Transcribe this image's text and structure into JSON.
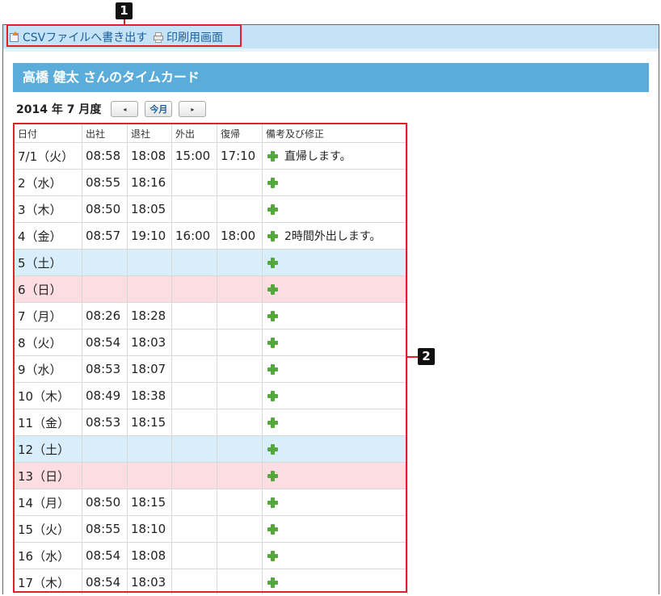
{
  "toolbar": {
    "csv_export": "CSVファイルへ書き出す",
    "print_view": "印刷用画面"
  },
  "page_title": "高橋 健太 さんのタイムカード",
  "month_nav": {
    "label": "2014 年 7 月度",
    "prev": "◂",
    "today": "今月",
    "next": "▸"
  },
  "table": {
    "headers": [
      "日付",
      "出社",
      "退社",
      "外出",
      "復帰",
      "備考及び修正"
    ],
    "rows": [
      {
        "date": "7/1（火）",
        "in": "08:58",
        "out": "18:08",
        "go_out": "15:00",
        "return": "17:10",
        "note": "直帰します。",
        "kind": ""
      },
      {
        "date": "2（水）",
        "in": "08:55",
        "out": "18:16",
        "go_out": "",
        "return": "",
        "note": "",
        "kind": ""
      },
      {
        "date": "3（木）",
        "in": "08:50",
        "out": "18:05",
        "go_out": "",
        "return": "",
        "note": "",
        "kind": ""
      },
      {
        "date": "4（金）",
        "in": "08:57",
        "out": "19:10",
        "go_out": "16:00",
        "return": "18:00",
        "note": "2時間外出します。",
        "kind": ""
      },
      {
        "date": "5（土）",
        "in": "",
        "out": "",
        "go_out": "",
        "return": "",
        "note": "",
        "kind": "sat"
      },
      {
        "date": "6（日）",
        "in": "",
        "out": "",
        "go_out": "",
        "return": "",
        "note": "",
        "kind": "sun"
      },
      {
        "date": "7（月）",
        "in": "08:26",
        "out": "18:28",
        "go_out": "",
        "return": "",
        "note": "",
        "kind": ""
      },
      {
        "date": "8（火）",
        "in": "08:54",
        "out": "18:03",
        "go_out": "",
        "return": "",
        "note": "",
        "kind": ""
      },
      {
        "date": "9（水）",
        "in": "08:53",
        "out": "18:07",
        "go_out": "",
        "return": "",
        "note": "",
        "kind": ""
      },
      {
        "date": "10（木）",
        "in": "08:49",
        "out": "18:38",
        "go_out": "",
        "return": "",
        "note": "",
        "kind": ""
      },
      {
        "date": "11（金）",
        "in": "08:53",
        "out": "18:15",
        "go_out": "",
        "return": "",
        "note": "",
        "kind": ""
      },
      {
        "date": "12（土）",
        "in": "",
        "out": "",
        "go_out": "",
        "return": "",
        "note": "",
        "kind": "sat"
      },
      {
        "date": "13（日）",
        "in": "",
        "out": "",
        "go_out": "",
        "return": "",
        "note": "",
        "kind": "sun"
      },
      {
        "date": "14（月）",
        "in": "08:50",
        "out": "18:15",
        "go_out": "",
        "return": "",
        "note": "",
        "kind": ""
      },
      {
        "date": "15（火）",
        "in": "08:55",
        "out": "18:10",
        "go_out": "",
        "return": "",
        "note": "",
        "kind": ""
      },
      {
        "date": "16（水）",
        "in": "08:54",
        "out": "18:08",
        "go_out": "",
        "return": "",
        "note": "",
        "kind": ""
      },
      {
        "date": "17（木）",
        "in": "08:54",
        "out": "18:03",
        "go_out": "",
        "return": "",
        "note": "",
        "kind": ""
      }
    ]
  },
  "callouts": {
    "one": "1",
    "two": "2"
  },
  "colors": {
    "title_bar": "#5aaddb",
    "toolbar": "#c5e3f6",
    "saturday_row": "#d8eefa",
    "sunday_row": "#fcdde2",
    "callout_red": "#e0202a"
  }
}
